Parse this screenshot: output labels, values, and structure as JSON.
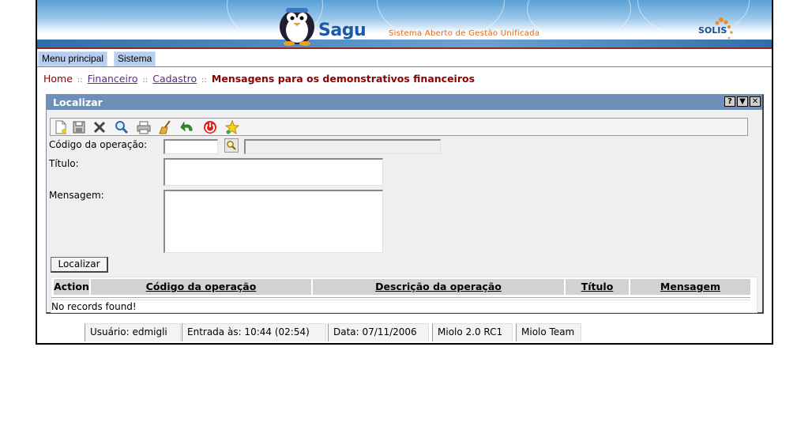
{
  "header": {
    "brand_name": "Sagu",
    "brand_tagline": "Sistema Aberto de Gestão Unificada",
    "partner_logo": "SOLIS"
  },
  "menu": {
    "items": [
      {
        "label": "Menu principal"
      },
      {
        "label": "Sistema"
      }
    ]
  },
  "breadcrumb": {
    "home": "Home",
    "level1": "Financeiro",
    "level2": "Cadastro",
    "current": "Mensagens para os demonstrativos financeiros",
    "separator": "::"
  },
  "panel": {
    "title": "Localizar",
    "window_buttons": [
      "?",
      "▼",
      "✕"
    ]
  },
  "toolbar": {
    "icons": [
      "new-document-icon",
      "save-icon",
      "delete-icon",
      "search-icon",
      "print-icon",
      "clear-broom-icon",
      "back-arrow-icon",
      "exit-power-icon",
      "favorite-star-icon"
    ]
  },
  "form": {
    "codigo_label": "Código da operação:",
    "codigo_value": "",
    "codigo_desc_value": "",
    "titulo_label": "Título:",
    "titulo_value": "",
    "mensagem_label": "Mensagem:",
    "mensagem_value": "",
    "search_button": "Localizar"
  },
  "grid": {
    "columns": [
      "Action",
      "Código da operação",
      "Descrição da operação",
      "Título",
      "Mensagem"
    ],
    "empty_text": "No records found!"
  },
  "status": {
    "user": "Usuário: edmigli",
    "entry": "Entrada às: 10:44 (02:54)",
    "date": "Data: 07/11/2006",
    "version": "Miolo 2.0 RC1",
    "team": "Miolo Team"
  },
  "colors": {
    "panel_title": "#6e90b8",
    "menu_item": "#b8cef0",
    "breadcrumb": "#8b0000",
    "brand_blue": "#1b5aa6",
    "tagline_orange": "#e06b18"
  }
}
